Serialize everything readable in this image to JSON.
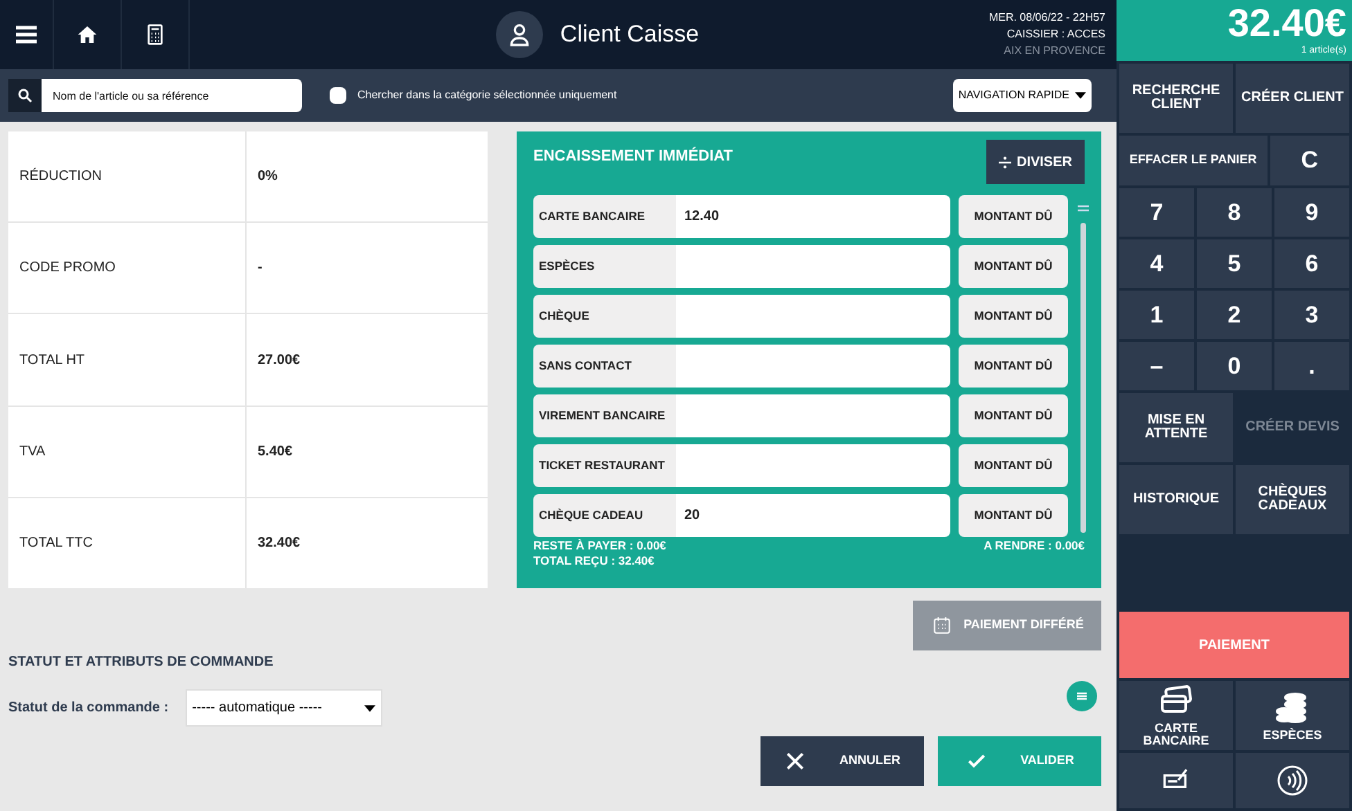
{
  "header": {
    "client": "Client Caisse",
    "date": "MER. 08/06/22 - 22H57",
    "cashier": "CAISSIER : ACCES",
    "location": "AIX EN PROVENCE",
    "total": "32.40€",
    "articles": "1 article(s)"
  },
  "toolbar": {
    "search_placeholder": "Nom de l'article ou sa référence",
    "filter": {
      "label": "Chercher dans la catégorie sélectionnée uniquement",
      "checked": false
    },
    "navigation": "NAVIGATION RAPIDE"
  },
  "summary": [
    {
      "label": "RÉDUCTION",
      "value": "0%"
    },
    {
      "label": "CODE PROMO",
      "value": "-"
    },
    {
      "label": "TOTAL HT",
      "value": "27.00€"
    },
    {
      "label": "TVA",
      "value": "5.40€"
    },
    {
      "label": "TOTAL TTC",
      "value": "32.40€"
    }
  ],
  "payment": {
    "title": "ENCAISSEMENT IMMÉDIAT",
    "split": "DIVISER",
    "methods": [
      {
        "name": "CARTE BANCAIRE",
        "value": "12.40",
        "button": "MONTANT DÛ"
      },
      {
        "name": "ESPÈCES",
        "button": "MONTANT DÛ"
      },
      {
        "name": "CHÈQUE",
        "button": "MONTANT DÛ"
      },
      {
        "name": "SANS CONTACT",
        "button": "MONTANT DÛ"
      },
      {
        "name": "VIREMENT BANCAIRE",
        "button": "MONTANT DÛ"
      },
      {
        "name": "TICKET RESTAURANT",
        "button": "MONTANT DÛ"
      },
      {
        "name": "CHÈQUE CADEAU",
        "value": "20",
        "button": "MONTANT DÛ"
      }
    ],
    "remaining": "RESTE À PAYER : 0.00€",
    "received": "TOTAL REÇU : 32.40€",
    "change": "A RENDRE : 0.00€"
  },
  "deferred": "PAIEMENT DIFFÉRÉ",
  "order_status": {
    "title": "STATUT ET ATTRIBUTS DE COMMANDE",
    "label": "Statut de la commande :",
    "value": "----- automatique -----"
  },
  "actions": {
    "cancel": "ANNULER",
    "validate": "VALIDER"
  },
  "right_panel": [
    [
      {
        "label": "RECHERCHE CLIENT",
        "kind": "normal",
        "disabled": false
      },
      {
        "label": "CRÉER CLIENT",
        "kind": "normal",
        "disabled": false
      }
    ],
    [
      {
        "label": "EFFACER LE PANIER",
        "kind": "wide",
        "disabled": false
      },
      {
        "label": "C",
        "kind": "key",
        "disabled": false
      }
    ],
    [
      {
        "label": "7",
        "kind": "key",
        "disabled": false
      },
      {
        "label": "8",
        "kind": "key",
        "disabled": false
      },
      {
        "label": "9",
        "kind": "key",
        "disabled": false
      }
    ],
    [
      {
        "label": "4",
        "kind": "key",
        "disabled": false
      },
      {
        "label": "5",
        "kind": "key",
        "disabled": false
      },
      {
        "label": "6",
        "kind": "key",
        "disabled": false
      }
    ],
    [
      {
        "label": "1",
        "kind": "key",
        "disabled": false
      },
      {
        "label": "2",
        "kind": "key",
        "disabled": false
      },
      {
        "label": "3",
        "kind": "key",
        "disabled": false
      }
    ],
    [
      {
        "label": "–",
        "kind": "key",
        "disabled": false
      },
      {
        "label": "0",
        "kind": "key",
        "disabled": false
      },
      {
        "label": ".",
        "kind": "key",
        "disabled": false
      }
    ],
    [
      {
        "label": "MISE EN ATTENTE",
        "kind": "normal",
        "disabled": false
      },
      {
        "label": "CRÉER DEVIS",
        "kind": "normal",
        "disabled": true
      }
    ],
    [
      {
        "label": "HISTORIQUE",
        "kind": "normal",
        "disabled": false
      },
      {
        "label": "CHÈQUES CADEAUX",
        "kind": "normal",
        "disabled": false
      }
    ]
  ],
  "pay_button": "PAIEMENT",
  "quick_methods": [
    {
      "label": "CARTE BANCAIRE",
      "kind": "card"
    },
    {
      "label": "ESPÈCES",
      "kind": "coins"
    }
  ]
}
